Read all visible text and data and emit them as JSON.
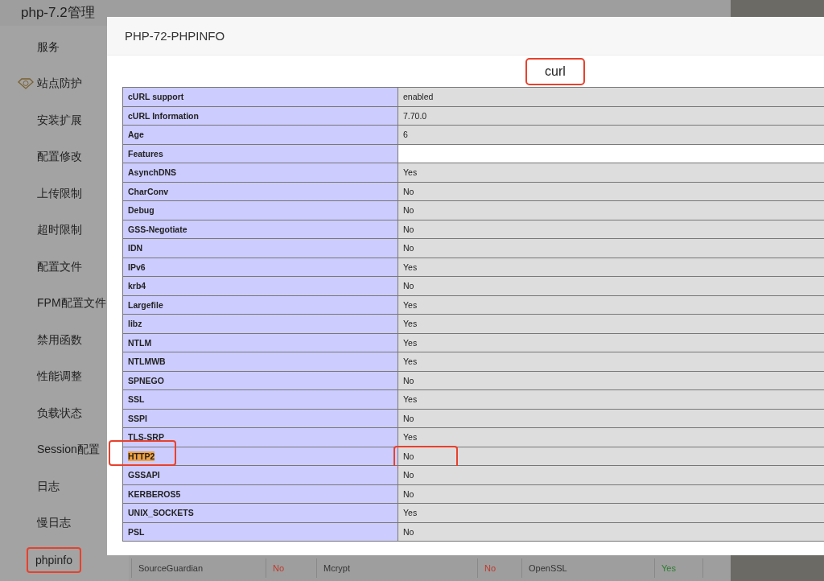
{
  "page_title": "php-7.2管理",
  "sidebar": {
    "items": [
      {
        "label": "服务",
        "kind": "plain",
        "highlighted": false
      },
      {
        "label": "站点防护",
        "kind": "pro",
        "highlighted": false
      },
      {
        "label": "安装扩展",
        "kind": "plain",
        "highlighted": false
      },
      {
        "label": "配置修改",
        "kind": "plain",
        "highlighted": false
      },
      {
        "label": "上传限制",
        "kind": "plain",
        "highlighted": false
      },
      {
        "label": "超时限制",
        "kind": "plain",
        "highlighted": false
      },
      {
        "label": "配置文件",
        "kind": "plain",
        "highlighted": false
      },
      {
        "label": "FPM配置文件",
        "kind": "plain",
        "highlighted": false
      },
      {
        "label": "禁用函数",
        "kind": "plain",
        "highlighted": false
      },
      {
        "label": "性能调整",
        "kind": "plain",
        "highlighted": false
      },
      {
        "label": "负载状态",
        "kind": "plain",
        "highlighted": false
      },
      {
        "label": "Session配置",
        "kind": "plain",
        "highlighted": false
      },
      {
        "label": "日志",
        "kind": "plain",
        "highlighted": false
      },
      {
        "label": "慢日志",
        "kind": "plain",
        "highlighted": false
      },
      {
        "label": "phpinfo",
        "kind": "plain",
        "highlighted": true
      }
    ]
  },
  "extension_row": [
    {
      "text": "SourceGuardian",
      "color": "#333333"
    },
    {
      "text": "No",
      "color": "#c0392b"
    },
    {
      "text": "Mcrypt",
      "color": "#333333"
    },
    {
      "text": "No",
      "color": "#c0392b"
    },
    {
      "text": "OpenSSL",
      "color": "#333333"
    },
    {
      "text": "Yes",
      "color": "#2e7d32"
    }
  ],
  "dialog": {
    "title": "PHP-72-PHPINFO",
    "section": {
      "heading": "curl",
      "highlighted": true
    },
    "rows": [
      {
        "name": "cURL support",
        "value": "enabled",
        "kind": "entry",
        "highlighted": false
      },
      {
        "name": "cURL Information",
        "value": "7.70.0",
        "kind": "entry",
        "highlighted": false
      },
      {
        "name": "Age",
        "value": "6",
        "kind": "entry",
        "highlighted": false
      },
      {
        "name": "Features",
        "kind": "header",
        "highlighted": false
      },
      {
        "name": "AsynchDNS",
        "value": "Yes",
        "kind": "entry",
        "highlighted": false
      },
      {
        "name": "CharConv",
        "value": "No",
        "kind": "entry",
        "highlighted": false
      },
      {
        "name": "Debug",
        "value": "No",
        "kind": "entry",
        "highlighted": false
      },
      {
        "name": "GSS-Negotiate",
        "value": "No",
        "kind": "entry",
        "highlighted": false
      },
      {
        "name": "IDN",
        "value": "No",
        "kind": "entry",
        "highlighted": false
      },
      {
        "name": "IPv6",
        "value": "Yes",
        "kind": "entry",
        "highlighted": false
      },
      {
        "name": "krb4",
        "value": "No",
        "kind": "entry",
        "highlighted": false
      },
      {
        "name": "Largefile",
        "value": "Yes",
        "kind": "entry",
        "highlighted": false
      },
      {
        "name": "libz",
        "value": "Yes",
        "kind": "entry",
        "highlighted": false
      },
      {
        "name": "NTLM",
        "value": "Yes",
        "kind": "entry",
        "highlighted": false
      },
      {
        "name": "NTLMWB",
        "value": "Yes",
        "kind": "entry",
        "highlighted": false
      },
      {
        "name": "SPNEGO",
        "value": "No",
        "kind": "entry",
        "highlighted": false
      },
      {
        "name": "SSL",
        "value": "Yes",
        "kind": "entry",
        "highlighted": false
      },
      {
        "name": "SSPI",
        "value": "No",
        "kind": "entry",
        "highlighted": false
      },
      {
        "name": "TLS-SRP",
        "value": "Yes",
        "kind": "entry",
        "highlighted": false
      },
      {
        "name": "HTTP2",
        "value": "No",
        "kind": "entry",
        "highlighted": true
      },
      {
        "name": "GSSAPI",
        "value": "No",
        "kind": "entry",
        "highlighted": false
      },
      {
        "name": "KERBEROS5",
        "value": "No",
        "kind": "entry",
        "highlighted": false
      },
      {
        "name": "UNIX_SOCKETS",
        "value": "Yes",
        "kind": "entry",
        "highlighted": false
      },
      {
        "name": "PSL",
        "value": "No",
        "kind": "entry",
        "highlighted": false
      }
    ]
  }
}
